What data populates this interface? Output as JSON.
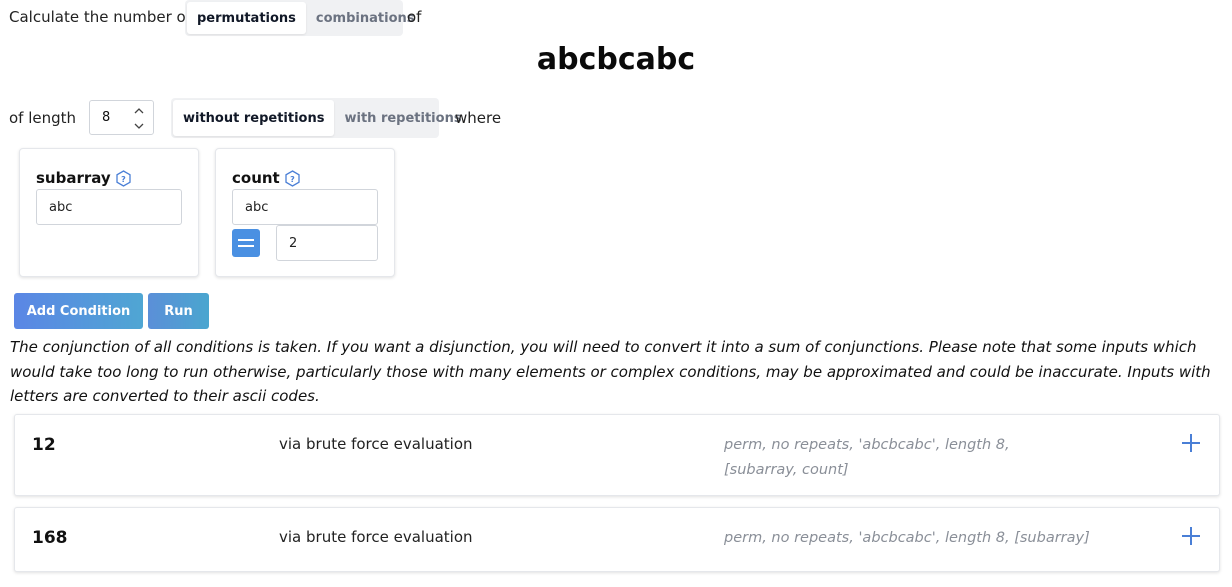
{
  "header": {
    "prefix": "Calculate the number of",
    "type_options": [
      "permutations",
      "combinations"
    ],
    "type_selected": "permutations",
    "suffix": "of"
  },
  "sequence": "abcbcabc",
  "length_row": {
    "prefix": "of length",
    "length_value": "8",
    "repetition_options": [
      "without repetitions",
      "with repetitions"
    ],
    "repetition_selected": "without repetitions",
    "suffix": "where"
  },
  "conditions": [
    {
      "title": "subarray",
      "value": "abc"
    },
    {
      "title": "count",
      "value": "abc",
      "operator": "=",
      "count_value": "2"
    }
  ],
  "buttons": {
    "add_condition": "Add Condition",
    "run": "Run"
  },
  "note": "The conjunction of all conditions is taken. If you want a disjunction, you will need to convert it into a sum of conjunctions. Please note that some inputs which would take too long to run otherwise, particularly those with many elements or complex conditions, may be approximated and could be inaccurate. Inputs with letters are converted to their ascii codes.",
  "results": [
    {
      "count": "12",
      "method": "via brute force evaluation",
      "detail": "perm, no repeats, 'abcbcabc', length 8, [subarray, count]"
    },
    {
      "count": "168",
      "method": "via brute force evaluation",
      "detail": "perm, no repeats, 'abcbcabc', length 8, [subarray]"
    }
  ],
  "colors": {
    "accent": "#4a90e2",
    "plus": "#4a7fd6",
    "muted_text": "#8a8f98"
  },
  "icons": [
    "help-icon",
    "equals-icon",
    "plus-icon",
    "chevron-up-icon",
    "chevron-down-icon"
  ]
}
